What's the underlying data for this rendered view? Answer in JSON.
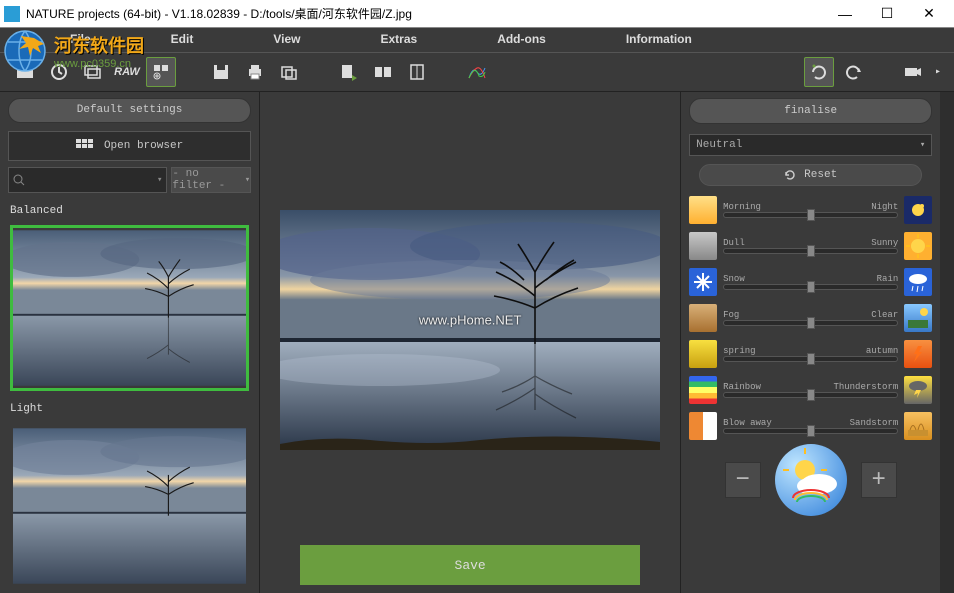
{
  "window": {
    "title": "NATURE projects (64-bit) - V1.18.02839 - D:/tools/桌面/河东软件园/Z.jpg",
    "min": "—",
    "max": "☐",
    "close": "✕"
  },
  "menu": {
    "file": "File",
    "edit": "Edit",
    "view": "View",
    "extras": "Extras",
    "addons": "Add-ons",
    "information": "Information"
  },
  "left": {
    "default_btn": "Default settings",
    "open_browser": "Open browser",
    "search_placeholder": "",
    "filter": "- no filter -",
    "preset1_label": "Balanced",
    "preset2_label": "Light"
  },
  "center": {
    "watermark": "www.pHome.NET",
    "save": "Save"
  },
  "right": {
    "finalise": "finalise",
    "selection": "Neutral",
    "reset": "Reset",
    "sliders": [
      {
        "left": "Morning",
        "right": "Night"
      },
      {
        "left": "Dull",
        "right": "Sunny"
      },
      {
        "left": "Snow",
        "right": "Rain"
      },
      {
        "left": "Fog",
        "right": "Clear"
      },
      {
        "left": "spring",
        "right": "autumn"
      },
      {
        "left": "Rainbow",
        "right": "Thunderstorm"
      },
      {
        "left": "Blow away",
        "right": "Sandstorm"
      }
    ]
  },
  "overlay": {
    "name": "河东软件园",
    "url": "www.pc0359.cn"
  }
}
